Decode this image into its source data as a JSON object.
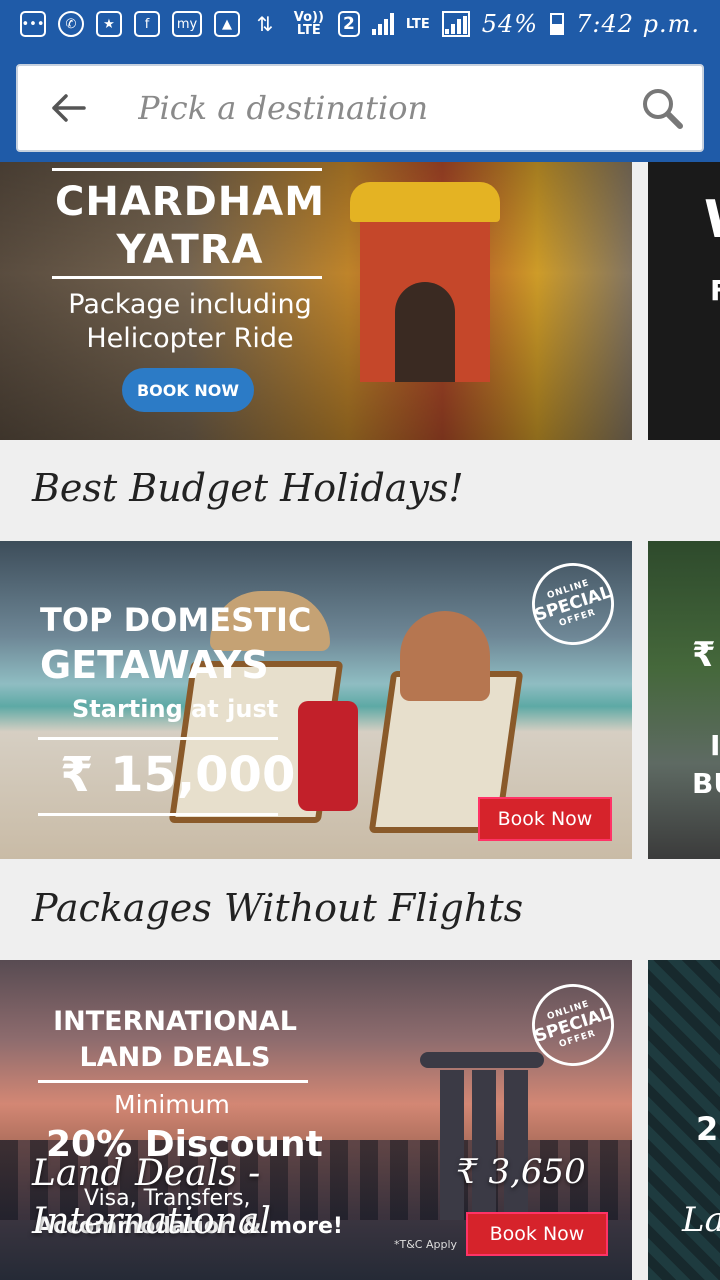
{
  "status_bar": {
    "notifications": [
      "chat",
      "whatsapp",
      "badge",
      "facebook",
      "my",
      "image",
      "sync"
    ],
    "network": "Vo)) LTE",
    "sim": "2",
    "lte": "LTE",
    "battery": "54%",
    "time": "7:42 p.m."
  },
  "search": {
    "placeholder": "Pick a destination"
  },
  "banner_chardham": {
    "title_line1": "CHARDHAM",
    "title_line2": "YATRA",
    "subtitle_line1": "Package including",
    "subtitle_line2": "Helicopter Ride",
    "cta": "BOOK NOW",
    "next_card_text1": "W",
    "next_card_text2": "F"
  },
  "section_budget": {
    "title": "Best Budget Holidays!"
  },
  "banner_domestic": {
    "line1": "TOP DOMESTIC",
    "line2": "GETAWAYS",
    "line3": "Starting at just",
    "price": "₹ 15,000",
    "badge_top": "ONLINE",
    "badge_mid": "SPECIAL",
    "badge_bot": "OFFER",
    "cta": "Book Now",
    "next_card_text1": "₹",
    "next_card_text2": "I",
    "next_card_text3": "BU"
  },
  "section_packages": {
    "title": "Packages Without Flights"
  },
  "banner_land": {
    "line1": "INTERNATIONAL",
    "line2": "LAND DEALS",
    "line3": "Minimum",
    "line4": "20% Discount",
    "line5": "Visa, Transfers,",
    "line6": "Accommodation & more!",
    "badge_top": "ONLINE",
    "badge_mid": "SPECIAL",
    "badge_bot": "OFFER",
    "tnc": "*T&C Apply",
    "cta": "Book Now",
    "package_name_line1": "Land Deals -",
    "package_name_line2": "International",
    "package_price": "₹ 3,650",
    "next_card_text1": "2",
    "next_card_text2": "La"
  }
}
